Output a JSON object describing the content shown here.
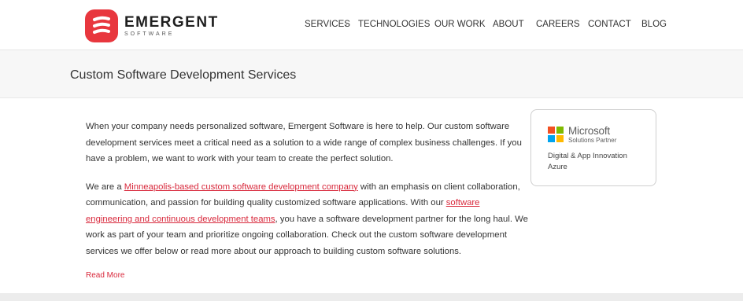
{
  "brand": {
    "name": "EMERGENT",
    "sub": "SOFTWARE",
    "color": "#e8373e"
  },
  "nav": {
    "services": "SERVICES",
    "technologies": "TECHNOLOGIES",
    "our_work": "OUR WORK",
    "about": "ABOUT",
    "careers": "CAREERS",
    "contact": "CONTACT",
    "blog": "BLOG",
    "services_icon": "chevron-down-icon"
  },
  "page": {
    "title": "Custom Software Development Services"
  },
  "content": {
    "p1": "When your company needs personalized software, Emergent Software is here to help. Our custom software development services meet a critical need as a solution to a wide range of complex business challenges. If you have a problem, we want to work with your team to create the perfect solution.",
    "p2_a": "We are a ",
    "p2_link1": "Minneapolis-based custom software development company",
    "p2_b": " with an emphasis on client collaboration, communication, and passion for building quality customized software applications. With our ",
    "p2_link2": "software engineering and continuous development teams",
    "p2_c": ", you have a software development partner for the long haul. We work as part of your team and prioritize ongoing collaboration. Check out the custom software development services we offer below or read more about our approach to building custom software solutions.",
    "read_more": "Read More",
    "link_color": "#d8283b"
  },
  "partner_badge": {
    "name": "Microsoft",
    "sub": "Solutions Partner",
    "line1": "Digital & App Innovation",
    "line2": "Azure",
    "logo_colors": [
      "#f25022",
      "#7fba00",
      "#00a4ef",
      "#ffb900"
    ]
  }
}
